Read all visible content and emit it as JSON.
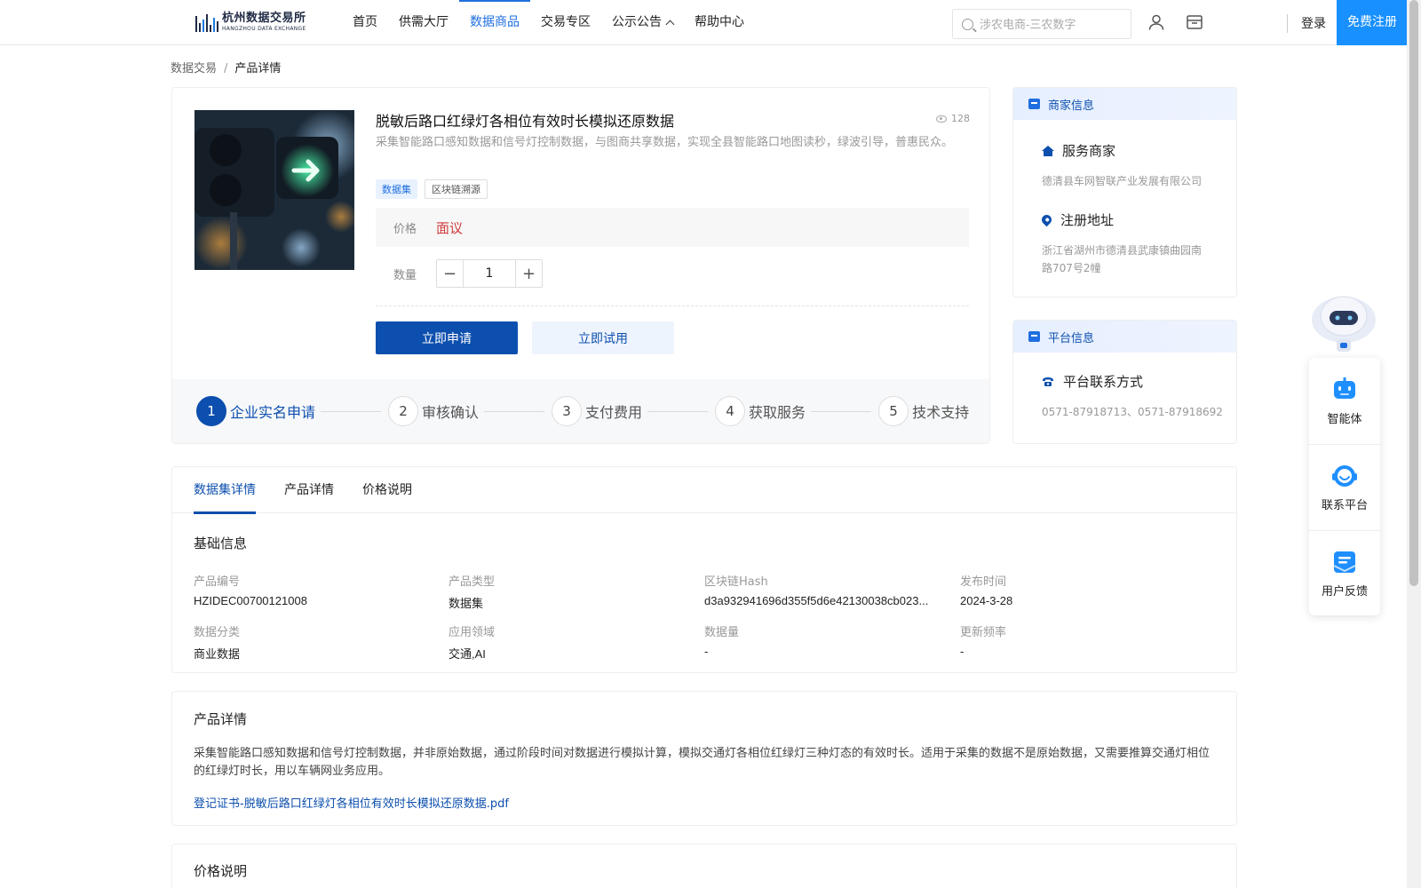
{
  "header": {
    "logo_cn": "杭州数据交易所",
    "logo_en": "HANGZHOU DATA EXCHANGE",
    "nav": [
      {
        "label": "首页"
      },
      {
        "label": "供需大厅"
      },
      {
        "label": "数据商品"
      },
      {
        "label": "交易专区"
      },
      {
        "label": "公示公告"
      },
      {
        "label": "帮助中心"
      }
    ],
    "search_placeholder": "涉农电商-三农数字",
    "login_label": "登录",
    "register_label": "免费注册",
    "active_color": "#1f6fe0"
  },
  "breadcrumb": {
    "root": "数据交易",
    "sep": "/",
    "current": "产品详情"
  },
  "product": {
    "title": "脱敏后路口红绿灯各相位有效时长模拟还原数据",
    "views": "128",
    "description": "采集智能路口感知数据和信号灯控制数据，与图商共享数据，实现全县智能路口地图读秒，绿波引导，普惠民众。",
    "tags": [
      "数据集",
      "区块链溯源"
    ],
    "price_label": "价格",
    "price_value": "面议",
    "quantity_label": "数量",
    "quantity_value": "1",
    "apply_button": "立即申请",
    "trial_button": "立即试用",
    "brand_color": "#0d4fae"
  },
  "steps": [
    {
      "num": "1",
      "label": "企业实名申请"
    },
    {
      "num": "2",
      "label": "审核确认"
    },
    {
      "num": "3",
      "label": "支付费用"
    },
    {
      "num": "4",
      "label": "获取服务"
    },
    {
      "num": "5",
      "label": "技术支持"
    }
  ],
  "merchant": {
    "header": "商家信息",
    "service_title": "服务商家",
    "service_value": "德清县车网智联产业发展有限公司",
    "address_title": "注册地址",
    "address_value": "浙江省湖州市德清县武康镇曲园南路707号2幢"
  },
  "platform": {
    "header": "平台信息",
    "contact_title": "平台联系方式",
    "contact_value": "0571-87918713、0571-87918692"
  },
  "tabs": [
    {
      "label": "数据集详情"
    },
    {
      "label": "产品详情"
    },
    {
      "label": "价格说明"
    }
  ],
  "basic_info": {
    "title": "基础信息",
    "fields": [
      {
        "label": "产品编号",
        "value": "HZIDEC00700121008"
      },
      {
        "label": "产品类型",
        "value": "数据集"
      },
      {
        "label": "区块链Hash",
        "value": "d3a932941696d355f5d6e42130038cb023..."
      },
      {
        "label": "发布时间",
        "value": "2024-3-28"
      },
      {
        "label": "数据分类",
        "value": "商业数据"
      },
      {
        "label": "应用领域",
        "value": "交通,AI"
      },
      {
        "label": "数据量",
        "value": "-"
      },
      {
        "label": "更新频率",
        "value": "-"
      }
    ]
  },
  "product_detail": {
    "title": "产品详情",
    "text": "采集智能路口感知数据和信号灯控制数据，并非原始数据，通过阶段时间对数据进行模拟计算，模拟交通灯各相位红绿灯三种灯态的有效时长。适用于采集的数据不是原始数据，又需要推算交通灯相位的红绿灯时长，用以车辆网业务应用。",
    "attachment": "登记证书-脱敏后路口红绿灯各相位有效时长模拟还原数据.pdf"
  },
  "price_note": {
    "title": "价格说明"
  },
  "float_widget": [
    {
      "label": "智能体",
      "icon": "robot-icon"
    },
    {
      "label": "联系平台",
      "icon": "headset-icon"
    },
    {
      "label": "用户反馈",
      "icon": "feedback-icon"
    }
  ]
}
